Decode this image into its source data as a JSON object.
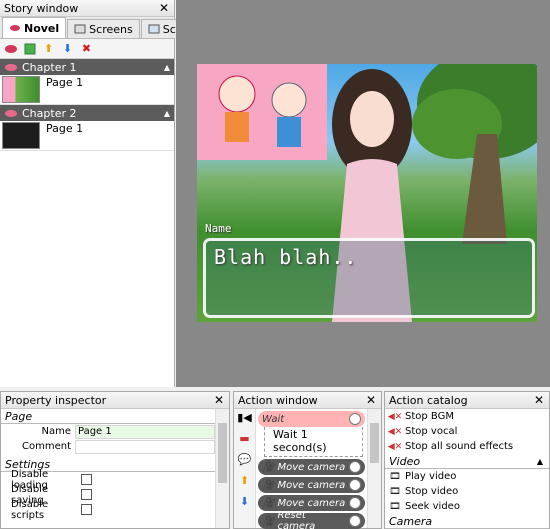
{
  "story": {
    "title": "Story window",
    "tabs": [
      {
        "label": "Novel"
      },
      {
        "label": "Screens"
      },
      {
        "label": "Scen"
      }
    ],
    "chapters": [
      {
        "label": "Chapter 1",
        "pages": [
          {
            "label": "Page 1"
          }
        ]
      },
      {
        "label": "Chapter 2",
        "pages": [
          {
            "label": "Page 1"
          }
        ]
      }
    ]
  },
  "stage": {
    "name_label": "Name",
    "dialog_text": "Blah blah.."
  },
  "property": {
    "title": "Property inspector",
    "section_page": "Page",
    "name_label": "Name",
    "name_value": "Page 1",
    "comment_label": "Comment",
    "section_settings": "Settings",
    "settings": [
      {
        "label": "Disable loading"
      },
      {
        "label": "Disable saving"
      },
      {
        "label": "Disable scripts"
      }
    ]
  },
  "action": {
    "title": "Action window",
    "wait_label": "Wait",
    "wait_line1": "Wait 1",
    "wait_line2": "second(s)",
    "items": [
      {
        "label": "Move camera"
      },
      {
        "label": "Move camera"
      },
      {
        "label": "Move camera"
      },
      {
        "label": "Reset camera"
      }
    ]
  },
  "catalog": {
    "title": "Action catalog",
    "audio_items": [
      {
        "label": "Stop BGM"
      },
      {
        "label": "Stop vocal"
      },
      {
        "label": "Stop all sound effects"
      }
    ],
    "video_section": "Video",
    "video_items": [
      {
        "label": "Play video"
      },
      {
        "label": "Stop video"
      },
      {
        "label": "Seek video"
      }
    ],
    "camera_section": "Camera"
  },
  "colors": {
    "chapter_bar": "#5c5c5c",
    "canvas_bg": "#888888",
    "wait_item": "#ffb3b3",
    "action_item": "#5a5a5a"
  }
}
